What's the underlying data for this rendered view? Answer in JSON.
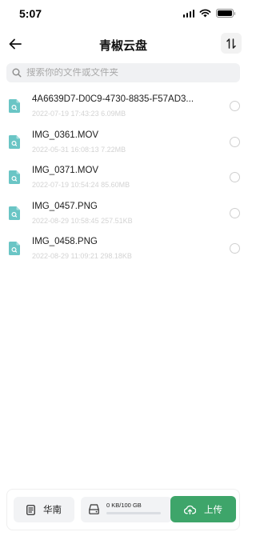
{
  "status_bar": {
    "time": "5:07"
  },
  "header": {
    "title": "青椒云盘"
  },
  "search": {
    "placeholder": "搜索你的文件或文件夹"
  },
  "files": [
    {
      "name": "4A6639D7-D0C9-4730-8835-F57AD3...",
      "meta": "2022-07-19 17:43:23 6.09MB",
      "selected": false
    },
    {
      "name": "IMG_0361.MOV",
      "meta": "2022-05-31 16:08:13 7.22MB",
      "selected": false
    },
    {
      "name": "IMG_0371.MOV",
      "meta": "2022-07-19 10:54:24 85.60MB",
      "selected": false
    },
    {
      "name": "IMG_0457.PNG",
      "meta": "2022-08-29 10:58:45 257.51KB",
      "selected": false
    },
    {
      "name": "IMG_0458.PNG",
      "meta": "2022-08-29 11:09:21 298.18KB",
      "selected": false
    }
  ],
  "bottom": {
    "region_label": "华南",
    "storage_text": "0 KB/100 GB",
    "storage_used_fraction": 0,
    "upload_label": "上传"
  },
  "colors": {
    "accent": "#3ea56a",
    "file_icon": "#6ac5c5",
    "search_bg": "#f0f1f3"
  },
  "icons": [
    "back-arrow-icon",
    "sort-icon",
    "search-icon",
    "file-icon",
    "document-icon",
    "hard-drive-icon",
    "cloud-upload-icon",
    "wifi-icon",
    "signal-icon",
    "battery-icon"
  ]
}
